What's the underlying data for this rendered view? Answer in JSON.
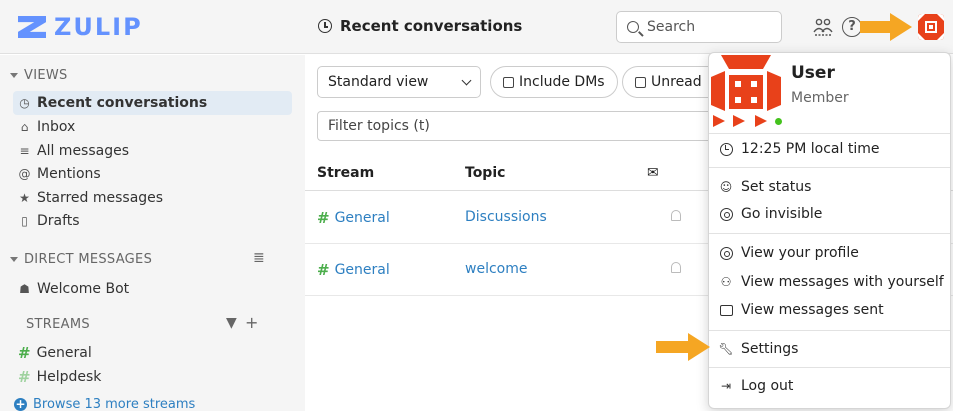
{
  "app": {
    "logo_text": "ZULIP",
    "brand_color": "#6492fe"
  },
  "navbar": {
    "title": "Recent conversations",
    "search_placeholder": "Search",
    "icons": [
      "clock-icon",
      "search-icon",
      "gear-users-icon",
      "help-icon",
      "avatar"
    ]
  },
  "sidebar": {
    "views_header": "VIEWS",
    "views": [
      {
        "label": "Recent conversations",
        "icon": "clock-icon",
        "active": true
      },
      {
        "label": "Inbox",
        "icon": "inbox-icon"
      },
      {
        "label": "All messages",
        "icon": "all-messages-icon"
      },
      {
        "label": "Mentions",
        "icon": "at-icon"
      },
      {
        "label": "Starred messages",
        "icon": "star-icon"
      },
      {
        "label": "Drafts",
        "icon": "drafts-icon"
      }
    ],
    "dm_header": "DIRECT MESSAGES",
    "dms": [
      {
        "label": "Welcome Bot",
        "icon": "bot-icon"
      }
    ],
    "streams_header": "STREAMS",
    "streams": [
      {
        "label": "General"
      },
      {
        "label": "Helpdesk"
      }
    ],
    "browse_label": "Browse 13 more streams"
  },
  "main": {
    "view_select": "Standard view",
    "include_dms": "Include DMs",
    "unread": "Unread",
    "filter_placeholder": "Filter topics (t)",
    "columns": {
      "stream": "Stream",
      "topic": "Topic"
    },
    "rows": [
      {
        "stream": "General",
        "topic": "Discussions"
      },
      {
        "stream": "General",
        "topic": "welcome"
      }
    ]
  },
  "popover": {
    "name": "User",
    "role": "Member",
    "local_time": "12:25 PM local time",
    "items": {
      "set_status": "Set status",
      "go_invisible": "Go invisible",
      "view_profile": "View your profile",
      "view_messages_self": "View messages with yourself",
      "view_messages_sent": "View messages sent",
      "settings": "Settings",
      "log_out": "Log out"
    }
  },
  "colors": {
    "accent_orange": "#f5a623",
    "avatar_red": "#e8411a",
    "stream_green": "#4cae4c",
    "link_blue": "#2d7fc1",
    "active_bg": "#e2ebf4",
    "presence_green": "#44c21d"
  }
}
